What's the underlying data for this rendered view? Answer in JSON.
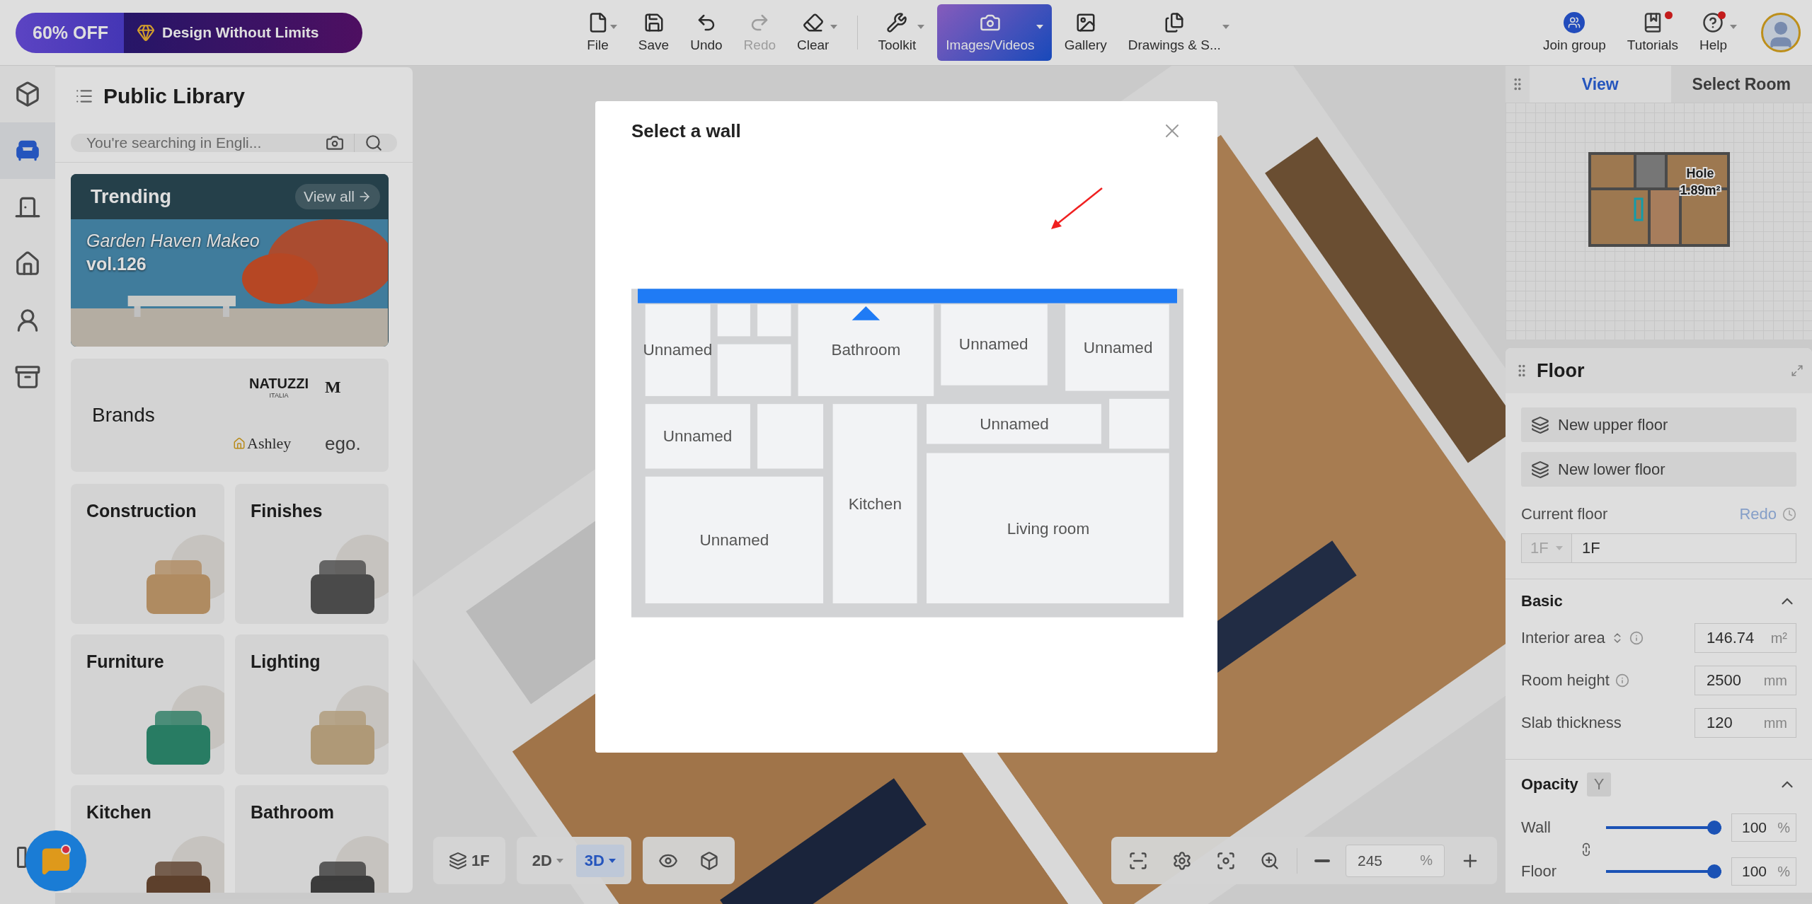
{
  "promo": {
    "discount": "60% OFF",
    "slogan": "Design Without Limits"
  },
  "toolbar": {
    "edit": [
      {
        "label": "File",
        "dropdown": true,
        "disabled": false
      },
      {
        "label": "Save",
        "dropdown": false,
        "disabled": false
      },
      {
        "label": "Undo",
        "dropdown": false,
        "disabled": false
      },
      {
        "label": "Redo",
        "dropdown": false,
        "disabled": true
      },
      {
        "label": "Clear",
        "dropdown": true,
        "disabled": false
      }
    ],
    "tools": [
      {
        "label": "Toolkit",
        "dropdown": true,
        "highlighted": false
      },
      {
        "label": "Images/Videos",
        "dropdown": true,
        "highlighted": true
      },
      {
        "label": "Gallery",
        "dropdown": false,
        "highlighted": false
      },
      {
        "label": "Drawings & S...",
        "dropdown": true,
        "highlighted": false
      }
    ]
  },
  "header_actions": [
    {
      "label": "Join group",
      "badge": false,
      "dropdown": false
    },
    {
      "label": "Tutorials",
      "badge": true,
      "dropdown": false
    },
    {
      "label": "Help",
      "badge": true,
      "dropdown": true
    }
  ],
  "rail": [
    {
      "selected": false
    },
    {
      "selected": true
    },
    {
      "selected": false
    },
    {
      "selected": false
    },
    {
      "selected": false
    },
    {
      "selected": false
    }
  ],
  "library": {
    "title": "Public Library",
    "search_placeholder": "You're searching in Engli...",
    "trending": {
      "title": "Trending",
      "link": "View all",
      "caption": "Garden Haven Makeo",
      "volume": "vol.126"
    },
    "brands": {
      "title": "Brands",
      "logos": [
        "NATUZZI",
        "ITALIA",
        "M",
        "Ashley",
        "ego."
      ]
    },
    "categories": [
      "Construction",
      "Finishes",
      "Furniture",
      "Lighting",
      "Kitchen",
      "Bathroom"
    ]
  },
  "chat": {
    "badge": true
  },
  "bottom_bar": {
    "floor": "1F",
    "modes": [
      {
        "label": "2D",
        "selected": false
      },
      {
        "label": "3D",
        "selected": true
      }
    ],
    "zoom": {
      "value": "245",
      "unit": "%"
    }
  },
  "right_panel": {
    "tabs": [
      {
        "label": "View",
        "selected": true
      },
      {
        "label": "Select Room",
        "selected": false
      }
    ],
    "minimap": {
      "label": "Hole",
      "area": "1.89m²"
    },
    "floor": {
      "title": "Floor",
      "actions": [
        "New upper floor",
        "New lower floor"
      ],
      "current_floor": {
        "label": "Current floor",
        "link": "Redo",
        "level": "1F",
        "name": "1F"
      },
      "basic": {
        "title": "Basic",
        "expanded": true,
        "fields": [
          {
            "label": "Interior area",
            "value": "146.74",
            "unit": "m²",
            "sortable": true,
            "info": true
          },
          {
            "label": "Room height",
            "value": "2500",
            "unit": "mm",
            "sortable": false,
            "info": true
          },
          {
            "label": "Slab thickness",
            "value": "120",
            "unit": "mm",
            "sortable": false,
            "info": false
          }
        ]
      },
      "opacity": {
        "title": "Opacity",
        "toggle": "Y",
        "expanded": true,
        "linked": true,
        "sliders": [
          {
            "label": "Wall",
            "level": 1,
            "value": "100",
            "unit": "%"
          },
          {
            "label": "Floor",
            "level": 1,
            "value": "100",
            "unit": "%"
          }
        ]
      }
    }
  },
  "modal": {
    "title": "Select a wall",
    "rooms": [
      "Unnamed",
      "Bathroom",
      "Unnamed",
      "Unnamed",
      "Unnamed",
      "Kitchen",
      "Unnamed",
      "Living room",
      "Unnamed"
    ]
  }
}
